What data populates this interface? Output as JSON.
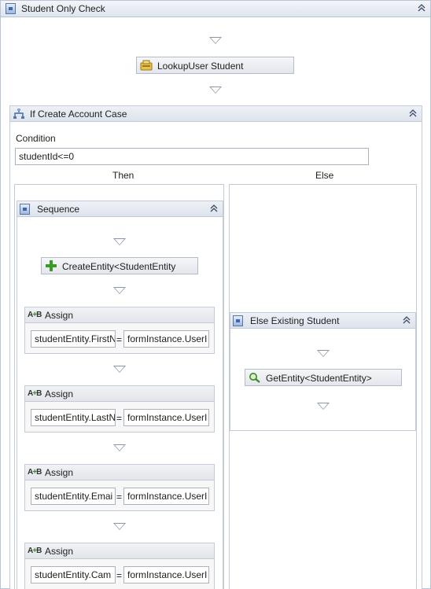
{
  "outer": {
    "title": "Student Only Check"
  },
  "lookup": {
    "label": "LookupUser Student"
  },
  "if_block": {
    "title": "If Create Account Case",
    "condition_label": "Condition",
    "condition_value": "studentId<=0",
    "then_label": "Then",
    "else_label": "Else"
  },
  "sequence": {
    "title": "Sequence"
  },
  "create_entity": {
    "label": "CreateEntity<StudentEntity"
  },
  "assigns": [
    {
      "title": "Assign",
      "to": "studentEntity.FirstN",
      "value": "formInstance.UserI"
    },
    {
      "title": "Assign",
      "to": "studentEntity.LastN",
      "value": "formInstance.UserI"
    },
    {
      "title": "Assign",
      "to": "studentEntity.Emai",
      "value": "formInstance.UserI"
    },
    {
      "title": "Assign",
      "to": "studentEntity.Cam",
      "value": "formInstance.UserI"
    }
  ],
  "assign_eq": "=",
  "else_seq": {
    "title": "Else Existing Student"
  },
  "get_entity": {
    "label": "GetEntity<StudentEntity>"
  },
  "colors": {
    "header_border": "#b7c3d6",
    "drop_arrow": "#8a96aa",
    "accent": "#3a68b0"
  }
}
